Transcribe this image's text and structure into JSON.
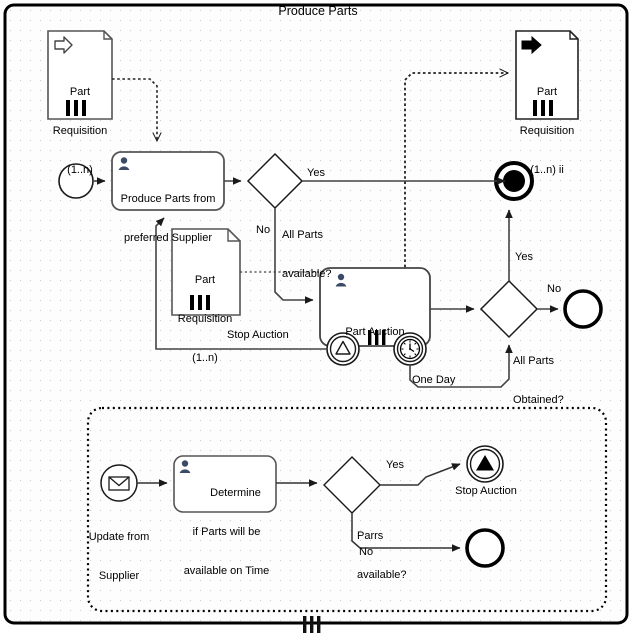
{
  "diagram": {
    "title": "Produce Parts",
    "type": "bpmn-process-diagram",
    "pool": {
      "multi_instance_marker": "|||"
    }
  },
  "data_objects": [
    {
      "id": "part-requisition-input",
      "name_lines": [
        "Part",
        "Requisition",
        "(1..n)"
      ],
      "marker": "input-arrow-hollow",
      "multi_instance_marker": "|||"
    },
    {
      "id": "part-requisition-middle",
      "name_lines": [
        "Part",
        "Requisition",
        "(1..n)"
      ],
      "marker": "none",
      "multi_instance_marker": "|||"
    },
    {
      "id": "part-requisition-output",
      "name_lines": [
        "Part",
        "Requisition",
        "(1..n) ii"
      ],
      "marker": "output-arrow-filled",
      "multi_instance_marker": "|||"
    }
  ],
  "tasks": [
    {
      "id": "produce-parts-task",
      "lines": [
        "Produce Parts from",
        "preferred Supplier"
      ],
      "icon": "user-icon"
    },
    {
      "id": "part-auction-task",
      "lines": [
        "Part Auction"
      ],
      "icon": "user-icon",
      "multi_instance_marker": "|||"
    },
    {
      "id": "determine-parts-task",
      "lines": [
        "Determine",
        "if Parts will be",
        "available on Time"
      ],
      "icon": "user-icon"
    }
  ],
  "gateways": [
    {
      "id": "all-parts-available-gateway",
      "lines": [
        "All Parts",
        "available?"
      ]
    },
    {
      "id": "all-parts-obtained-gateway",
      "lines": [
        "All Parts",
        "Obtained?"
      ]
    },
    {
      "id": "parts-available-gateway",
      "lines": [
        "Parrs",
        "available?"
      ]
    }
  ],
  "events": [
    {
      "id": "start-event",
      "type": "start-none",
      "label": ""
    },
    {
      "id": "terminate-end-event",
      "type": "end-terminate",
      "label": ""
    },
    {
      "id": "end-event-no",
      "type": "end-none",
      "label": ""
    },
    {
      "id": "signal-boundary-event",
      "type": "boundary-signal",
      "label": ""
    },
    {
      "id": "timer-boundary-event",
      "type": "boundary-timer",
      "label": ""
    },
    {
      "id": "message-start-event",
      "type": "start-message",
      "label_lines": [
        "Update from",
        "Supplier"
      ]
    },
    {
      "id": "signal-end-event",
      "type": "end-signal",
      "label": "Stop Auction"
    },
    {
      "id": "subprocess-end-event",
      "type": "end-none",
      "label": ""
    }
  ],
  "flow_labels": {
    "yes_top": "Yes",
    "no_top": "No",
    "stop_auction": "Stop Auction",
    "one_day": "One Day",
    "yes_right": "Yes",
    "no_right": "No",
    "yes_bottom": "Yes",
    "no_bottom": "No",
    "stop_auction_end": "Stop Auction"
  }
}
